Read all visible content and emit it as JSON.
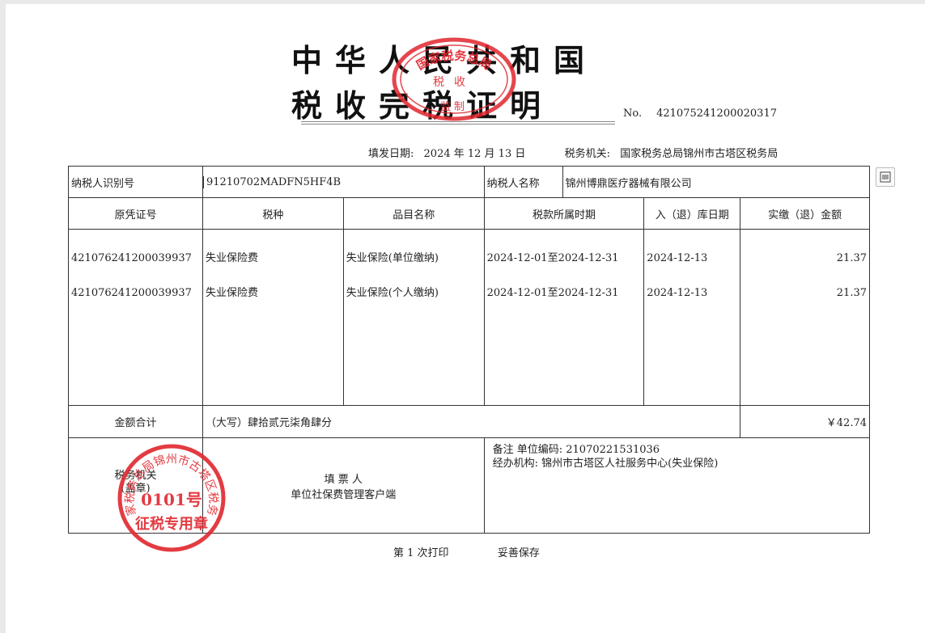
{
  "header": {
    "title_line1": "中华人民共和国",
    "title_line2": "税收完税证明",
    "no_label": "No.",
    "no_value": "421075241200020317"
  },
  "meta": {
    "date_label": "填发日期:",
    "date_value": "2024 年 12 月 13 日",
    "authority_label": "税务机关:",
    "authority_value": "国家税务总局锦州市古塔区税务局"
  },
  "taxpayer": {
    "id_label": "纳税人识别号",
    "id_value": "91210702MADFN5HF4B",
    "name_label": "纳税人名称",
    "name_value": "锦州博鼎医疗器械有限公司"
  },
  "columns": [
    "原凭证号",
    "税种",
    "品目名称",
    "税款所属时期",
    "入（退）库日期",
    "实缴（退）金额"
  ],
  "rows": [
    {
      "voucher": "421076241200039937",
      "tax": "失业保险费",
      "item": "失业保险(单位缴纳)",
      "period": "2024-12-01至2024-12-31",
      "date": "2024-12-13",
      "amount": "21.37"
    },
    {
      "voucher": "421076241200039937",
      "tax": "失业保险费",
      "item": "失业保险(个人缴纳)",
      "period": "2024-12-01至2024-12-31",
      "date": "2024-12-13",
      "amount": "21.37"
    }
  ],
  "total": {
    "label": "金额合计",
    "words": "（大写）肆拾贰元柒角肆分",
    "value": "￥42.74"
  },
  "bottom": {
    "authority_label": "税务机关",
    "seal_word": "(盖章)",
    "filler_label": "填 票 人",
    "filler_value": "单位社保费管理客户端",
    "remark_line1": "备注  单位编码: 21070221531036",
    "remark_line2": "经办机构: 锦州市古塔区人社服务中心(失业保险)"
  },
  "stamp_top": {
    "outer_text": "国家税务总局",
    "mid_text": "税收",
    "bottom_text": "监制"
  },
  "stamp_bottom": {
    "ring_text": "国家税务总局锦州市古塔区税务局",
    "number": "0101号",
    "purpose": "征税专用章"
  },
  "footer": {
    "print_count": "第 1 次打印",
    "keep": "妥善保存"
  },
  "colors": {
    "seal_red": "#e0262e"
  },
  "icons": {
    "side_button": "qr-scan-icon"
  }
}
